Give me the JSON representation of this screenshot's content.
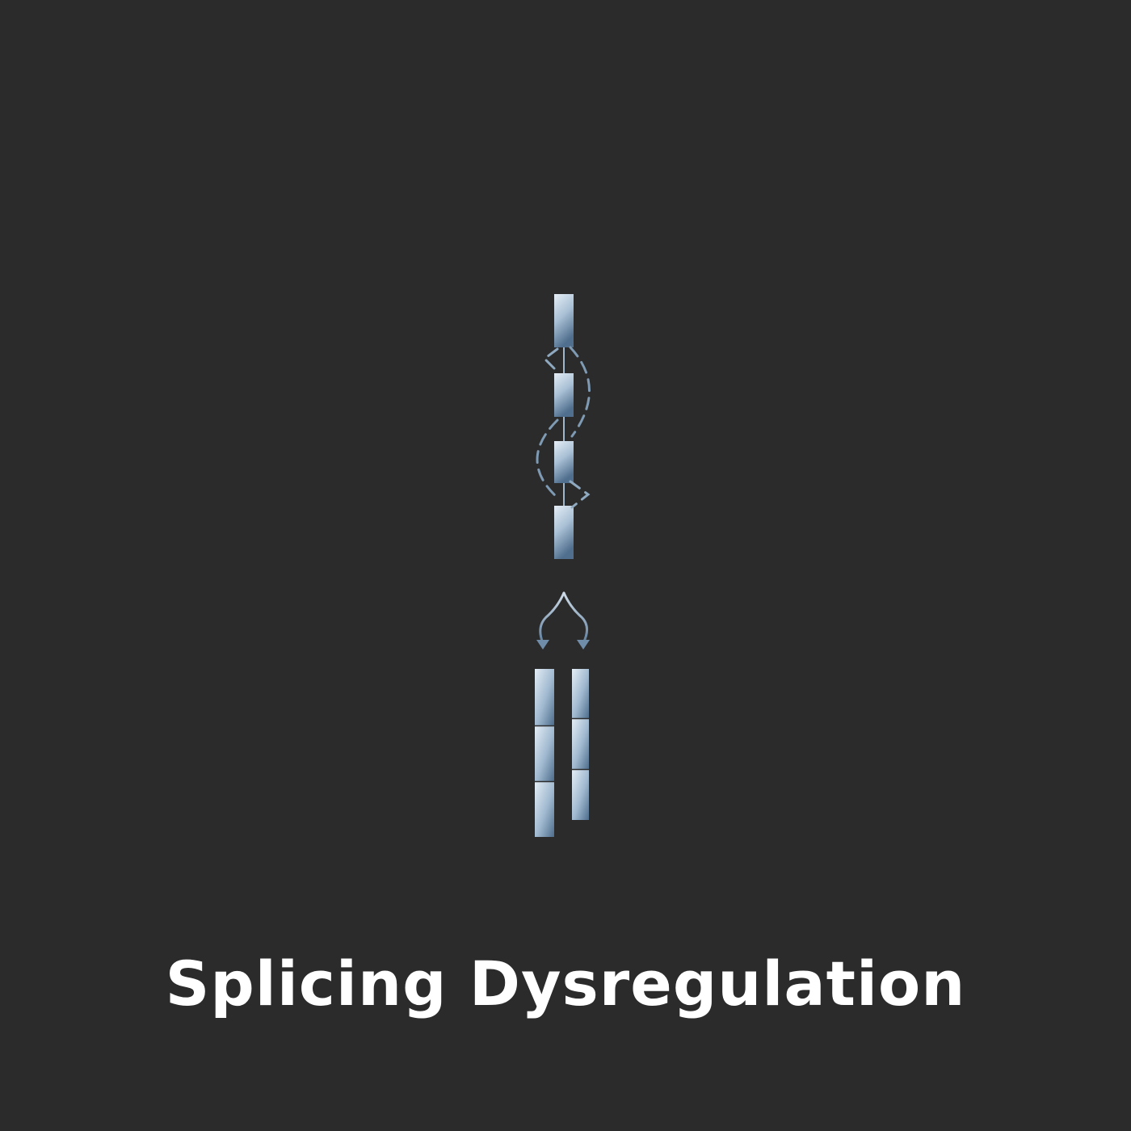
{
  "caption": "Splicing Dysregulation",
  "colors": {
    "background": "#2b2b2b",
    "exon_light": "#dfe9f2",
    "exon_dark": "#4d6d8c",
    "connector": "#8fa9c0",
    "caption": "#ffffff"
  },
  "icons": {
    "pre_mrna": "pre-mrna-strand-icon",
    "splice_loops": "dashed-splice-loop-icon",
    "fork": "branching-arrows-icon",
    "isoforms": "mrna-isoform-icon"
  }
}
